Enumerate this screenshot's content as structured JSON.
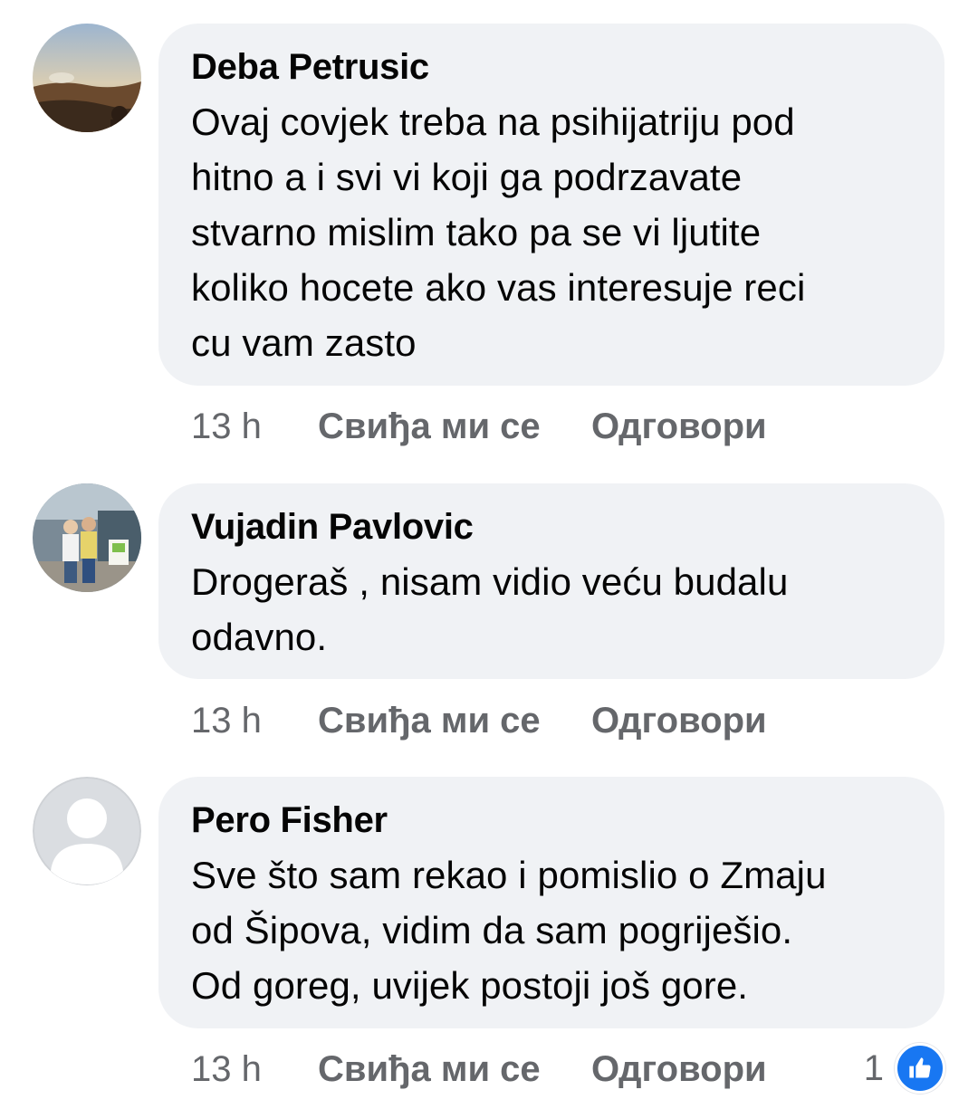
{
  "comments": [
    {
      "author": "Deba Petrusic",
      "text": "Ovaj covjek treba na psihijatriju pod\nhitno a i svi vi koji ga podrzavate\nstvarno mislim tako pa se vi ljutite\nkoliko hocete ako vas interesuje reci\ncu vam zasto",
      "time": "13 h",
      "like_label": "Свиђа ми се",
      "reply_label": "Одговори",
      "avatar_icon": "landscape-photo-avatar"
    },
    {
      "author": "Vujadin Pavlovic",
      "text": "Drogeraš , nisam vidio veću budalu\nodavno.",
      "time": "13 h",
      "like_label": "Свиђа ми се",
      "reply_label": "Одговори",
      "avatar_icon": "couple-photo-avatar"
    },
    {
      "author": "Pero Fisher",
      "text": "Sve što sam rekao i pomislio o Zmaju\nod Šipova, vidim da sam pogriješio.\nOd goreg, uvijek postoji još gore.",
      "time": "13 h",
      "like_label": "Свиђа ми се",
      "reply_label": "Одговори",
      "reaction_count": "1",
      "reaction_icon": "thumbs-up-icon",
      "avatar_icon": "default-user-avatar"
    }
  ],
  "colors": {
    "bubble": "#f0f2f5",
    "secondary_text": "#65676b",
    "like_blue": "#1877f2"
  }
}
